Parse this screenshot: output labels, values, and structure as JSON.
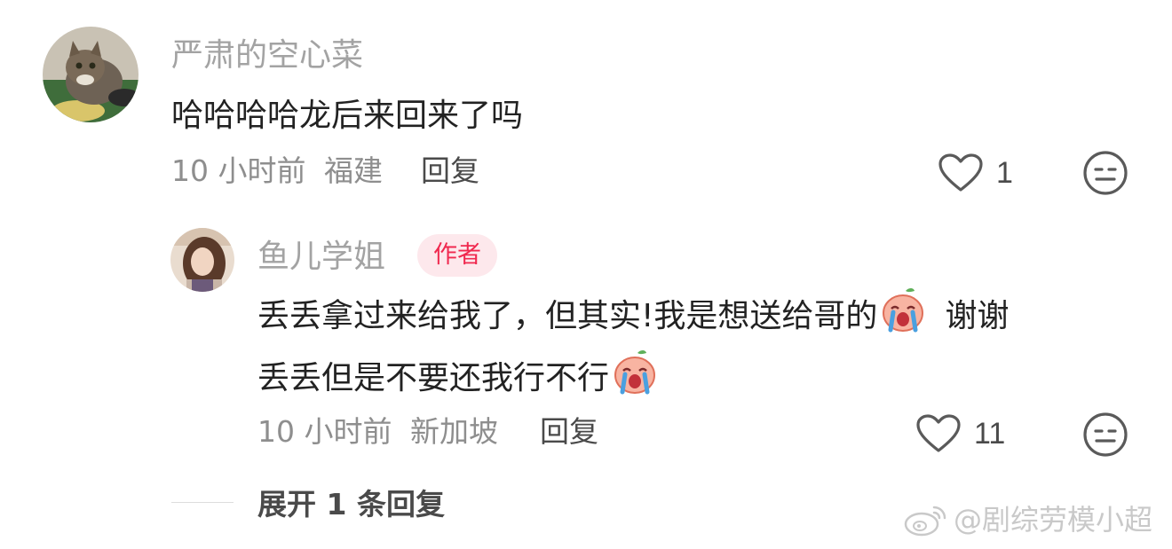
{
  "comment": {
    "username": "严肃的空心菜",
    "text": "哈哈哈哈龙后来回来了吗",
    "time": "10 小时前",
    "location": "福建",
    "reply_label": "回复",
    "like_count": "1",
    "avatar_icon": "cat-avatar",
    "like_icon": "heart-outline-icon",
    "dislike_icon": "meh-face-icon"
  },
  "reply": {
    "username": "鱼儿学姐",
    "author_badge": "作者",
    "text_line1_part1": "丢丢拿过来给我了，但其实!我是想送给哥的",
    "text_line1_part2": "谢谢",
    "text_line2": "丢丢但是不要还我行不行",
    "time": "10 小时前",
    "location": "新加坡",
    "reply_label": "回复",
    "like_count": "11",
    "avatar_icon": "girl-avatar",
    "emoji_icon": "crying-emoji"
  },
  "expand_replies": "展开 1 条回复",
  "watermark": {
    "text": "@剧综劳模小超",
    "icon": "weibo-logo"
  },
  "colors": {
    "username": "#a3a3a3",
    "text": "#222222",
    "meta": "#8e8e8e",
    "badge_bg": "#fde8ec",
    "badge_text": "#f0294f"
  }
}
